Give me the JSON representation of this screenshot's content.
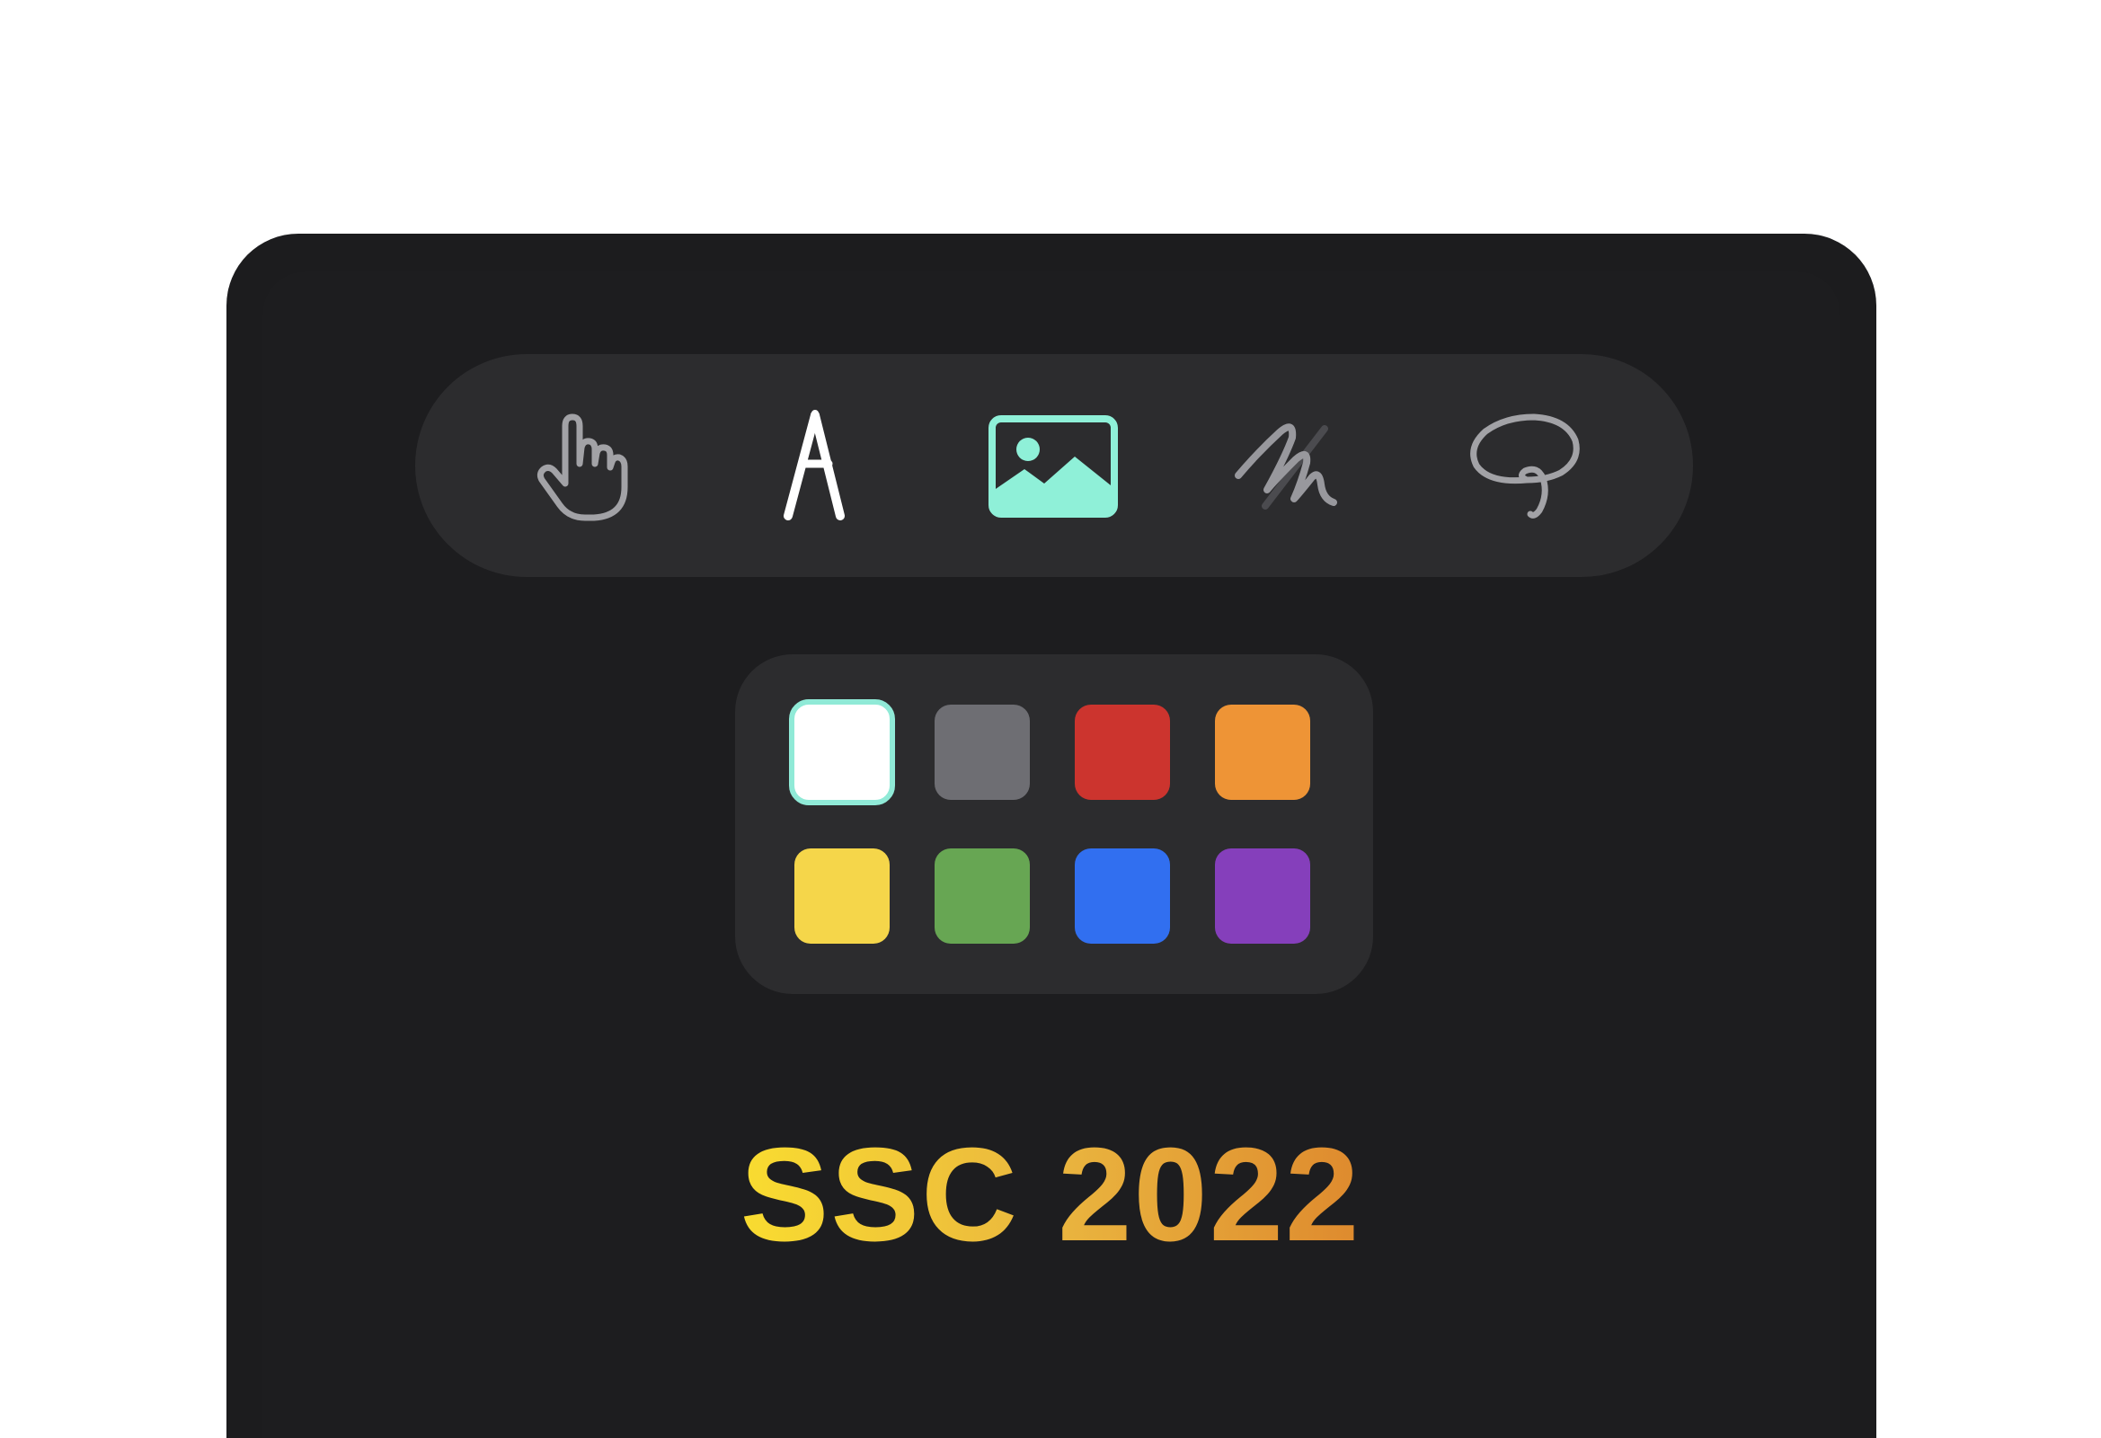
{
  "toolbar": {
    "tools": [
      {
        "name": "hand-tool",
        "icon": "hand-pointer-icon"
      },
      {
        "name": "compass-tool",
        "icon": "drafting-compass-icon"
      },
      {
        "name": "image-tool",
        "icon": "image-icon",
        "selected": true
      },
      {
        "name": "scribble-tool",
        "icon": "scribble-pen-icon"
      },
      {
        "name": "lasso-tool",
        "icon": "lasso-icon"
      }
    ],
    "accent_color": "#8ff0d8"
  },
  "palette": {
    "colors": [
      {
        "name": "white",
        "hex": "#ffffff",
        "selected": true
      },
      {
        "name": "gray",
        "hex": "#6e6e73"
      },
      {
        "name": "red",
        "hex": "#cc342e"
      },
      {
        "name": "orange",
        "hex": "#ee9436"
      },
      {
        "name": "yellow",
        "hex": "#f5d64a"
      },
      {
        "name": "green",
        "hex": "#67a653"
      },
      {
        "name": "blue",
        "hex": "#316ff0"
      },
      {
        "name": "purple",
        "hex": "#853fbb"
      }
    ]
  },
  "title": {
    "text": "SSC 2022",
    "gradient": [
      "#f9dc30",
      "#de8a2e"
    ]
  }
}
